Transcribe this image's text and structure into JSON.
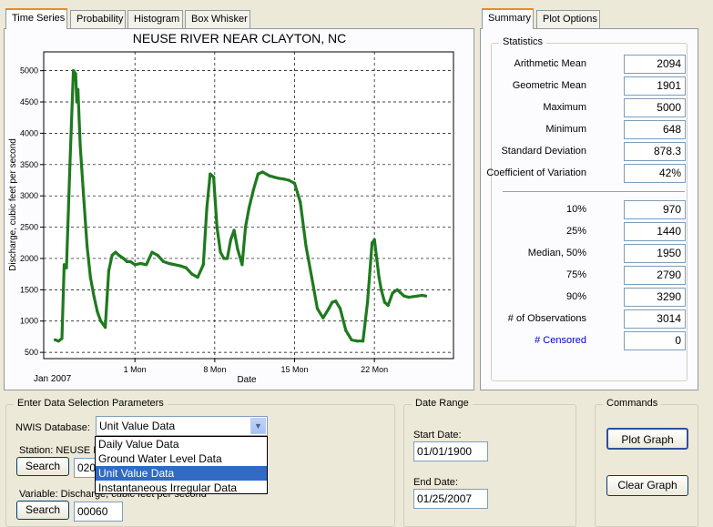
{
  "graph_tabs": [
    "Time Series",
    "Probability",
    "Histogram",
    "Box Whisker"
  ],
  "summary_tabs": [
    "Summary",
    "Plot Options"
  ],
  "colors": {
    "series": "#1e7a1e",
    "censored_link": "#0000cc",
    "selection": "#316ac5"
  },
  "chart_data": {
    "type": "line",
    "title": "NEUSE RIVER NEAR CLAYTON, NC",
    "ylabel": "Discharge, cubic feet per second",
    "xlabel": "Date",
    "ylim": [
      400,
      5300
    ],
    "yticks": [
      500,
      1000,
      1500,
      2000,
      2500,
      3000,
      3500,
      4000,
      4500,
      5000
    ],
    "xlim": [
      -1,
      28
    ],
    "xticks": [
      {
        "day": 7,
        "label": "1 Mon"
      },
      {
        "day": 14,
        "label": "8 Mon"
      },
      {
        "day": 21,
        "label": "15 Mon"
      },
      {
        "day": 28,
        "label": "22 Mon"
      }
    ],
    "xstart_label": "Jan 2007",
    "grid": true,
    "series": [
      {
        "x": [
          0,
          0.3,
          0.6,
          0.8,
          1.0,
          1.3,
          1.6,
          1.8,
          1.9,
          2.0,
          2.2,
          2.5,
          2.8,
          3.1,
          3.4,
          3.7,
          4.0,
          4.4,
          4.7,
          5.0,
          5.3,
          5.6,
          6.0,
          6.3,
          6.6,
          7.0,
          7.5,
          8.0,
          8.5,
          9.0,
          9.5,
          10.0,
          10.5,
          11.0,
          11.5,
          12.0,
          12.5,
          13.0,
          13.3,
          13.6,
          13.9,
          14.2,
          14.5,
          14.8,
          15.1,
          15.4,
          15.7,
          16.0,
          16.4,
          16.7,
          17.0,
          17.4,
          17.8,
          18.2,
          18.5,
          18.8,
          19.2,
          19.6,
          20.0,
          20.5,
          21.0,
          21.5,
          22.0,
          22.5,
          23.0,
          23.5,
          24.0,
          24.3,
          24.6,
          25.0,
          25.5,
          26.0,
          26.5,
          27.0,
          27.4,
          27.8,
          28.0,
          28.2,
          28.4,
          28.6,
          28.9,
          29.2,
          29.6,
          30.0,
          30.3,
          30.6,
          31.0,
          31.4,
          31.8,
          32.2,
          32.5
        ],
        "y": [
          700,
          680,
          720,
          1900,
          1850,
          3500,
          5000,
          4950,
          4500,
          4700,
          3800,
          3000,
          2200,
          1700,
          1400,
          1150,
          1000,
          900,
          1800,
          2050,
          2100,
          2050,
          2000,
          1950,
          1950,
          1900,
          1920,
          1900,
          2100,
          2050,
          1950,
          1920,
          1900,
          1880,
          1850,
          1750,
          1700,
          1900,
          2800,
          3350,
          3300,
          2500,
          2100,
          2000,
          2000,
          2300,
          2450,
          2150,
          1900,
          2500,
          2800,
          3100,
          3350,
          3380,
          3350,
          3320,
          3300,
          3280,
          3270,
          3250,
          3200,
          2900,
          2200,
          1700,
          1200,
          1050,
          1200,
          1300,
          1320,
          1200,
          850,
          700,
          680,
          680,
          1300,
          2250,
          2300,
          2000,
          1700,
          1500,
          1300,
          1250,
          1450,
          1500,
          1450,
          1400,
          1380,
          1390,
          1400,
          1410,
          1400
        ]
      }
    ]
  },
  "statistics": {
    "title": "Statistics",
    "rows": [
      {
        "label": "Arithmetic Mean",
        "value": "2094"
      },
      {
        "label": "Geometric Mean",
        "value": "1901"
      },
      {
        "label": "Maximum",
        "value": "5000"
      },
      {
        "label": "Minimum",
        "value": "648"
      },
      {
        "label": "Standard Deviation",
        "value": "878.3"
      },
      {
        "label": "Coefficient of Variation",
        "value": "42%"
      }
    ],
    "percentile_rows": [
      {
        "label": "10%",
        "value": "970"
      },
      {
        "label": "25%",
        "value": "1440"
      },
      {
        "label": "Median, 50%",
        "value": "1950"
      },
      {
        "label": "75%",
        "value": "2790"
      },
      {
        "label": "90%",
        "value": "3290"
      },
      {
        "label": "# of Observations",
        "value": "3014"
      }
    ],
    "censored": {
      "label": "# Censored",
      "value": "0"
    }
  },
  "selection": {
    "title": "Enter Data Selection Parameters",
    "nwis_label": "NWIS Database:",
    "nwis_value": "Unit Value Data",
    "dropdown_options": [
      "Daily Value Data",
      "Ground Water Level Data",
      "Unit Value Data",
      "Instantaneous Irregular Data"
    ],
    "station_label": "Station: NEUSE R",
    "station_value": "020",
    "variable_label": "Variable: Discharge, cubic feet per second",
    "variable_value": "00060",
    "search_label": "Search"
  },
  "date_range": {
    "title": "Date Range",
    "start_label": "Start Date:",
    "start_value": "01/01/1900",
    "end_label": "End Date:",
    "end_value": "01/25/2007"
  },
  "commands": {
    "title": "Commands",
    "plot_label": "Plot Graph",
    "clear_label": "Clear Graph"
  }
}
